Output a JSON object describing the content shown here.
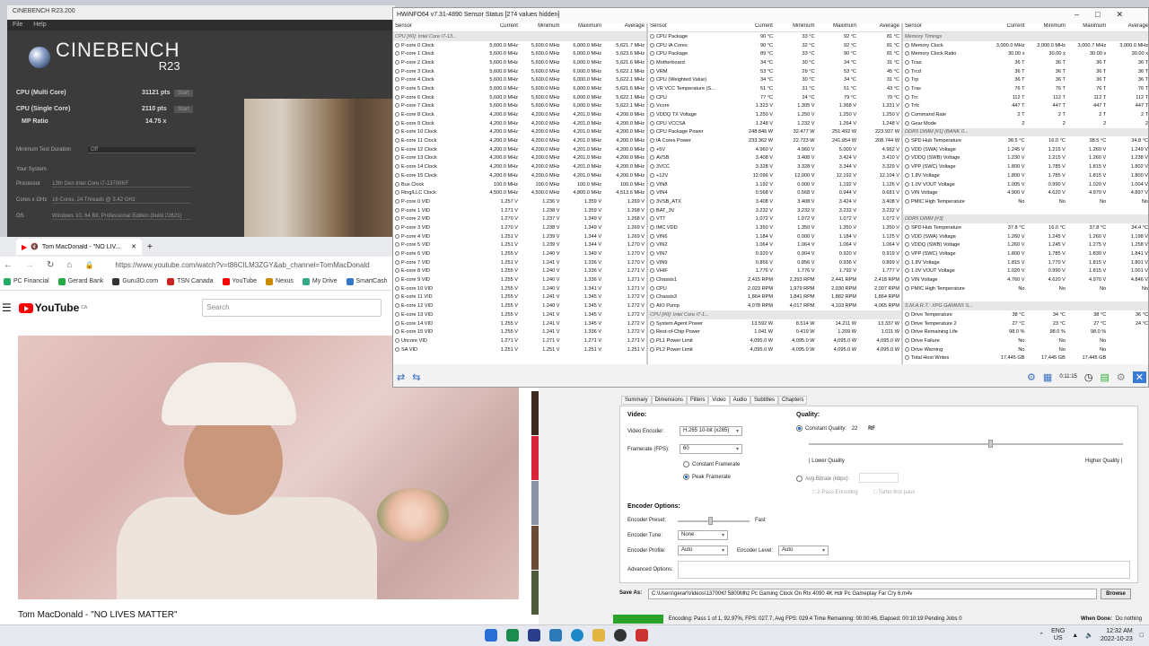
{
  "cinebench": {
    "title": "CINEBENCH R23.200",
    "menu": [
      "File",
      "Help"
    ],
    "logo_main": "CINEBENCH",
    "logo_sub": "R23",
    "cpu_multi_label": "CPU (Multi Core)",
    "cpu_multi_val": "31121 pts",
    "cpu_single_label": "CPU (Single Core)",
    "cpu_single_val": "2110 pts",
    "mp_label": "MP Ratio",
    "mp_val": "14.75 x",
    "start": "Start",
    "min_duration_label": "Minimum Test Duration",
    "min_duration_val": "Off",
    "your_system": "Your System",
    "processor_label": "Processor",
    "processor_val": "13th Gen Intel Core i7-13700KF",
    "cores_label": "Cores x GHz",
    "cores_val": "16 Cores, 24 Threads @ 3.42 GHz",
    "os_label": "OS",
    "os_val": "Windows 10, 64 Bit, Professional Edition (build 22621)"
  },
  "browser": {
    "tab_title": "Tom MacDonald - \"NO LIV...",
    "new_tab": "+",
    "url": "https://www.youtube.com/watch?v=t86CILM3ZGY&ab_channel=TomMacDonald",
    "bookmarks": [
      "PC Financial",
      "Gerard Bank",
      "Guru3D.com",
      "TSN Canada",
      "YouTube",
      "Nexus",
      "My Drive",
      "SmartCash"
    ],
    "yt_logo": "YouTube",
    "yt_region": "CA",
    "search_placeholder": "Search",
    "video_title": "Tom MacDonald - \"NO LIVES MATTER\"",
    "thumbs": [
      {
        "time": "2:3",
        "color": "#3a2a20"
      },
      {
        "time": "3:5",
        "color": "#d8253a"
      },
      {
        "time": "3:4",
        "color": "#8a93a3"
      },
      {
        "time": "4:0",
        "color": "#6b4b35"
      },
      {
        "time": "",
        "color": "#4e5a3c"
      }
    ]
  },
  "hwinfo": {
    "title": "HWiNFO64 v7.31-4890 Sensor Status [274 values hidden]",
    "elapsed": "0:11:15",
    "headers": [
      "Sensor",
      "Current",
      "Minimum",
      "Maximum",
      "Average"
    ],
    "col1": [
      [
        "CPU [#0]: Intel Core i7-13...",
        "",
        "",
        "",
        "",
        1
      ],
      [
        "P-core 0 Clock",
        "5,600.0 MHz",
        "5,600.0 MHz",
        "6,000.0 MHz",
        "5,621.7 MHz"
      ],
      [
        "P-core 1 Clock",
        "5,600.0 MHz",
        "5,600.0 MHz",
        "6,000.0 MHz",
        "5,623.6 MHz"
      ],
      [
        "P-core 2 Clock",
        "5,600.0 MHz",
        "5,600.0 MHz",
        "6,000.0 MHz",
        "5,621.6 MHz"
      ],
      [
        "P-core 3 Clock",
        "5,600.0 MHz",
        "5,600.0 MHz",
        "6,000.0 MHz",
        "5,622.1 MHz"
      ],
      [
        "P-core 4 Clock",
        "5,600.0 MHz",
        "5,600.0 MHz",
        "6,000.0 MHz",
        "5,622.1 MHz"
      ],
      [
        "P-core 5 Clock",
        "5,600.0 MHz",
        "5,600.0 MHz",
        "6,000.0 MHz",
        "5,621.6 MHz"
      ],
      [
        "P-core 6 Clock",
        "5,600.0 MHz",
        "5,600.0 MHz",
        "6,000.0 MHz",
        "5,622.1 MHz"
      ],
      [
        "P-core 7 Clock",
        "5,600.0 MHz",
        "5,600.0 MHz",
        "6,000.0 MHz",
        "5,622.1 MHz"
      ],
      [
        "E-core 8 Clock",
        "4,200.0 MHz",
        "4,200.0 MHz",
        "4,201.0 MHz",
        "4,200.0 MHz"
      ],
      [
        "E-core 9 Clock",
        "4,200.0 MHz",
        "4,200.0 MHz",
        "4,201.0 MHz",
        "4,200.0 MHz"
      ],
      [
        "E-core 10 Clock",
        "4,200.0 MHz",
        "4,200.0 MHz",
        "4,201.0 MHz",
        "4,200.0 MHz"
      ],
      [
        "E-core 11 Clock",
        "4,200.0 MHz",
        "4,200.0 MHz",
        "4,201.0 MHz",
        "4,200.0 MHz"
      ],
      [
        "E-core 12 Clock",
        "4,200.0 MHz",
        "4,200.0 MHz",
        "4,201.0 MHz",
        "4,200.0 MHz"
      ],
      [
        "E-core 13 Clock",
        "4,200.0 MHz",
        "4,200.0 MHz",
        "4,201.0 MHz",
        "4,200.0 MHz"
      ],
      [
        "E-core 14 Clock",
        "4,200.0 MHz",
        "4,200.0 MHz",
        "4,201.0 MHz",
        "4,200.0 MHz"
      ],
      [
        "E-core 15 Clock",
        "4,200.0 MHz",
        "4,200.0 MHz",
        "4,201.0 MHz",
        "4,200.0 MHz"
      ],
      [
        "Bus Clock",
        "100.0 MHz",
        "100.0 MHz",
        "100.0 MHz",
        "100.0 MHz"
      ],
      [
        "Ring/LLC Clock",
        "4,500.0 MHz",
        "4,500.0 MHz",
        "4,800.0 MHz",
        "4,513.6 MHz"
      ],
      [
        "P-core 0 VID",
        "1.257 V",
        "1.236 V",
        "1.359 V",
        "1.269 V"
      ],
      [
        "P-core 1 VID",
        "1.271 V",
        "1.238 V",
        "1.359 V",
        "1.268 V"
      ],
      [
        "P-core 2 VID",
        "1.270 V",
        "1.237 V",
        "1.349 V",
        "1.268 V"
      ],
      [
        "P-core 3 VID",
        "1.270 V",
        "1.238 V",
        "1.349 V",
        "1.269 V"
      ],
      [
        "P-core 4 VID",
        "1.251 V",
        "1.239 V",
        "1.344 V",
        "1.269 V"
      ],
      [
        "P-core 5 VID",
        "1.251 V",
        "1.239 V",
        "1.344 V",
        "1.270 V"
      ],
      [
        "P-core 6 VID",
        "1.255 V",
        "1.240 V",
        "1.349 V",
        "1.270 V"
      ],
      [
        "P-core 7 VID",
        "1.251 V",
        "1.241 V",
        "1.336 V",
        "1.270 V"
      ],
      [
        "E-core 8 VID",
        "1.255 V",
        "1.240 V",
        "1.336 V",
        "1.271 V"
      ],
      [
        "E-core 9 VID",
        "1.255 V",
        "1.240 V",
        "1.336 V",
        "1.271 V"
      ],
      [
        "E-core 10 VID",
        "1.255 V",
        "1.240 V",
        "1.341 V",
        "1.271 V"
      ],
      [
        "E-core 11 VID",
        "1.255 V",
        "1.241 V",
        "1.345 V",
        "1.272 V"
      ],
      [
        "E-core 12 VID",
        "1.255 V",
        "1.240 V",
        "1.345 V",
        "1.272 V"
      ],
      [
        "E-core 13 VID",
        "1.255 V",
        "1.241 V",
        "1.345 V",
        "1.272 V"
      ],
      [
        "E-core 14 VID",
        "1.255 V",
        "1.241 V",
        "1.345 V",
        "1.272 V"
      ],
      [
        "E-core 15 VID",
        "1.255 V",
        "1.241 V",
        "1.336 V",
        "1.272 V"
      ],
      [
        "Uncore VID",
        "1.271 V",
        "1.271 V",
        "1.271 V",
        "1.271 V"
      ],
      [
        "SA VID",
        "1.251 V",
        "1.251 V",
        "1.251 V",
        "1.251 V"
      ]
    ],
    "col2": [
      [
        "CPU Package",
        "90 °C",
        "33 °C",
        "92 °C",
        "81 °C"
      ],
      [
        "CPU IA Cores",
        "90 °C",
        "32 °C",
        "92 °C",
        "81 °C"
      ],
      [
        "CPU Package",
        "89 °C",
        "33 °C",
        "90 °C",
        "81 °C"
      ],
      [
        "Motherboard",
        "34 °C",
        "30 °C",
        "34 °C",
        "31 °C"
      ],
      [
        "VRM",
        "53 °C",
        "29 °C",
        "53 °C",
        "45 °C"
      ],
      [
        "CPU (Weighted Value)",
        "34 °C",
        "30 °C",
        "34 °C",
        "31 °C"
      ],
      [
        "VR VCC Temperature (S...",
        "51 °C",
        "31 °C",
        "51 °C",
        "43 °C"
      ],
      [
        "CPU",
        "77 °C",
        "24 °C",
        "79 °C",
        "70 °C"
      ],
      [
        "Vcore",
        "1.323 V",
        "1.305 V",
        "1.368 V",
        "1.331 V"
      ],
      [
        "VDDQ TX Voltage",
        "1.250 V",
        "1.250 V",
        "1.250 V",
        "1.250 V"
      ],
      [
        "CPU VCCSA",
        "1.248 V",
        "1.232 V",
        "1.264 V",
        "1.248 V"
      ],
      [
        "CPU Package Power",
        "248.846 W",
        "32.477 W",
        "251.492 W",
        "223.937 W"
      ],
      [
        "IA Cores Power",
        "233.362 W",
        "22.723 W",
        "241.954 W",
        "208.744 W"
      ],
      [
        "+5V",
        "4.960 V",
        "4.960 V",
        "5.000 V",
        "4.962 V"
      ],
      [
        "AVSB",
        "3.408 V",
        "3.408 V",
        "3.424 V",
        "3.410 V"
      ],
      [
        "3VCC",
        "3.328 V",
        "3.328 V",
        "3.344 V",
        "3.329 V"
      ],
      [
        "+12V",
        "12.096 V",
        "12.000 V",
        "12.192 V",
        "12.104 V"
      ],
      [
        "VIN8",
        "1.192 V",
        "0.000 V",
        "1.192 V",
        "1.126 V"
      ],
      [
        "VIN4",
        "0.568 V",
        "0.568 V",
        "0.944 V",
        "0.681 V"
      ],
      [
        "3VSB_ATX",
        "3.408 V",
        "3.408 V",
        "3.424 V",
        "3.408 V"
      ],
      [
        "BAT_3V",
        "3.232 V",
        "3.232 V",
        "3.232 V",
        "3.232 V"
      ],
      [
        "VTT",
        "1.072 V",
        "1.072 V",
        "1.072 V",
        "1.072 V"
      ],
      [
        "IMC VDD",
        "1.350 V",
        "1.350 V",
        "1.350 V",
        "1.350 V"
      ],
      [
        "VIN6",
        "1.184 V",
        "0.000 V",
        "1.184 V",
        "1.125 V"
      ],
      [
        "VIN2",
        "1.064 V",
        "1.064 V",
        "1.064 V",
        "1.064 V"
      ],
      [
        "VIN7",
        "0.920 V",
        "0.904 V",
        "0.920 V",
        "0.919 V"
      ],
      [
        "VIN9",
        "0.856 V",
        "0.856 V",
        "0.936 V",
        "0.899 V"
      ],
      [
        "VHIF",
        "1.776 V",
        "1.776 V",
        "1.792 V",
        "1.777 V"
      ],
      [
        "Chassis1",
        "2,415 RPM",
        "2,393 RPM",
        "2,441 RPM",
        "2,418 RPM"
      ],
      [
        "CPU",
        "2,023 RPM",
        "1,979 RPM",
        "2,030 RPM",
        "2,007 RPM"
      ],
      [
        "Chassis3",
        "1,864 RPM",
        "1,841 RPM",
        "1,882 RPM",
        "1,864 RPM"
      ],
      [
        "AIO Pump",
        "4,078 RPM",
        "4,017 RPM",
        "4,103 RPM",
        "4,065 RPM"
      ],
      [
        "CPU [#0]: Intel Core i7-1...",
        "",
        "",
        "",
        "",
        1
      ],
      [
        "System Agent Power",
        "13.592 W",
        "8.514 W",
        "14.211 W",
        "13.337 W"
      ],
      [
        "Rest-of-Chip Power",
        "1.041 W",
        "0.419 W",
        "1.209 W",
        "1.011 W"
      ],
      [
        "PL1 Power Limit",
        "4,095.0 W",
        "4,095.0 W",
        "4,095.0 W",
        "4,095.0 W"
      ],
      [
        "PL2 Power Limit",
        "4,095.0 W",
        "4,095.0 W",
        "4,095.0 W",
        "4,095.0 W"
      ]
    ],
    "col3": [
      [
        "Memory Timings",
        "",
        "",
        "",
        "",
        1
      ],
      [
        "Memory Clock",
        "3,000.0 MHz",
        "3,000.0 MHz",
        "3,000.7 MHz",
        "3,000.0 MHz"
      ],
      [
        "Memory Clock Ratio",
        "30.00 x",
        "30.00 x",
        "30.00 x",
        "30.00 x"
      ],
      [
        "Tcas",
        "36 T",
        "36 T",
        "36 T",
        "36 T"
      ],
      [
        "Trcd",
        "36 T",
        "36 T",
        "36 T",
        "36 T"
      ],
      [
        "Trp",
        "36 T",
        "36 T",
        "36 T",
        "36 T"
      ],
      [
        "Tras",
        "76 T",
        "76 T",
        "76 T",
        "76 T"
      ],
      [
        "Trc",
        "112 T",
        "112 T",
        "112 T",
        "112 T"
      ],
      [
        "Trfc",
        "447 T",
        "447 T",
        "447 T",
        "447 T"
      ],
      [
        "Command Rate",
        "2 T",
        "2 T",
        "2 T",
        "2 T"
      ],
      [
        "Gear Mode",
        "2",
        "2",
        "2",
        "2"
      ],
      [
        "DDR5 DIMM [#1] (BANK 0...",
        "",
        "",
        "",
        "",
        1
      ],
      [
        "SPD Hub Temperature",
        "38.5 °C",
        "16.0 °C",
        "38.5 °C",
        "34.8 °C"
      ],
      [
        "VDD (SWA) Voltage",
        "1.245 V",
        "1.215 V",
        "1.260 V",
        "1.249 V"
      ],
      [
        "VDDQ (SWB) Voltage",
        "1.230 V",
        "1.215 V",
        "1.260 V",
        "1.238 V"
      ],
      [
        "VPP (SWC) Voltage",
        "1.800 V",
        "1.785 V",
        "1.815 V",
        "1.802 V"
      ],
      [
        "1.8V Voltage",
        "1.800 V",
        "1.785 V",
        "1.815 V",
        "1.800 V"
      ],
      [
        "1.0V VOUT Voltage",
        "1.005 V",
        "0.990 V",
        "1.020 V",
        "1.004 V"
      ],
      [
        "VIN Voltage",
        "4.900 V",
        "4.620 V",
        "4.970 V",
        "4.897 V"
      ],
      [
        "PMIC High Temperature",
        "No",
        "No",
        "No",
        "No"
      ],
      [
        "",
        "",
        "",
        "",
        "",
        2
      ],
      [
        "DDR5 DIMM [#3]",
        "",
        "",
        "",
        "",
        1
      ],
      [
        "SPD Hub Temperature",
        "37.8 °C",
        "16.0 °C",
        "37.8 °C",
        "34.4 °C"
      ],
      [
        "VDD (SWA) Voltage",
        "1.260 V",
        "1.245 V",
        "1.260 V",
        "1.198 V"
      ],
      [
        "VDDQ (SWB) Voltage",
        "1.260 V",
        "1.245 V",
        "1.275 V",
        "1.258 V"
      ],
      [
        "VPP (SWC) Voltage",
        "1.800 V",
        "1.785 V",
        "1.830 V",
        "1.841 V"
      ],
      [
        "1.8V Voltage",
        "1.815 V",
        "1.770 V",
        "1.815 V",
        "1.801 V"
      ],
      [
        "1.0V VOUT Voltage",
        "1.020 V",
        "0.990 V",
        "1.815 V",
        "1.001 V"
      ],
      [
        "VIN Voltage",
        "4.760 V",
        "4.620 V",
        "4.970 V",
        "4.846 V"
      ],
      [
        "PMIC High Temperature",
        "No",
        "No",
        "No",
        "No"
      ],
      [
        "",
        "",
        "",
        "",
        "",
        2
      ],
      [
        "S.M.A.R.T.: XPG GAMMIX S...",
        "",
        "",
        "",
        "",
        1
      ],
      [
        "Drive Temperature",
        "38 °C",
        "34 °C",
        "38 °C",
        "36 °C"
      ],
      [
        "Drive Temperature 2",
        "27 °C",
        "23 °C",
        "27 °C",
        "24 °C"
      ],
      [
        "Drive Remaining Life",
        "98.0 %",
        "98.0 %",
        "98.0 %",
        ""
      ],
      [
        "Drive Failure",
        "No",
        "No",
        "No",
        ""
      ],
      [
        "Drive Warning",
        "No",
        "No",
        "No",
        ""
      ],
      [
        "Total Host Writes",
        "17,445 GB",
        "17,445 GB",
        "17,445 GB",
        ""
      ]
    ]
  },
  "handbrake": {
    "tabs": [
      "Summary",
      "Dimensions",
      "Filters",
      "Video",
      "Audio",
      "Subtitles",
      "Chapters"
    ],
    "video_h": "Video:",
    "encoder_label": "Video Encoder:",
    "encoder_val": "H.265 10-bit (x265)",
    "fps_label": "Framerate (FPS):",
    "fps_val": "60",
    "cfr": "Constant Framerate",
    "pfr": "Peak Framerate",
    "quality_h": "Quality:",
    "cq": "Constant Quality:",
    "cq_val": "22",
    "rf": "RF",
    "lower": "| Lower Quality",
    "higher": "Higher Quality |",
    "avgbr": "Avg Bitrate (kbps):",
    "twopass": "2-Pass Encoding",
    "turbo": "Turbo first pass",
    "enc_opt_h": "Encoder Options:",
    "preset_label": "Encoder Preset:",
    "preset_val": "Fast",
    "tune_label": "Encoder Tune:",
    "tune_val": "None",
    "profile_label": "Encoder Profile:",
    "profile_val": "Auto",
    "level_label": "Encoder Level:",
    "level_val": "Auto",
    "adv_label": "Advanced Options:",
    "save_label": "Save As:",
    "path": "C:\\Users\\gerar\\Videos\\13700Kf 5800Mhz Pc Gaming Clock On Rtx 4090 4K Hdr Pc Gameplay Far Cry 6.m4v",
    "browse": "Browse",
    "status": "Encoding: Pass 1 of 1,  92.97%, FPS: 027.7,  Avg FPS: 029.4 Time Remaining: 00:00:46,  Elapsed: 00:10:19    Pending Jobs 0",
    "progress": 0.9297,
    "when_done_label": "When Done:",
    "when_done_val": "Do nothing"
  },
  "taskbar": {
    "lang": "ENG",
    "region": "US",
    "time": "12:32 AM",
    "date": "2022-10-23"
  }
}
